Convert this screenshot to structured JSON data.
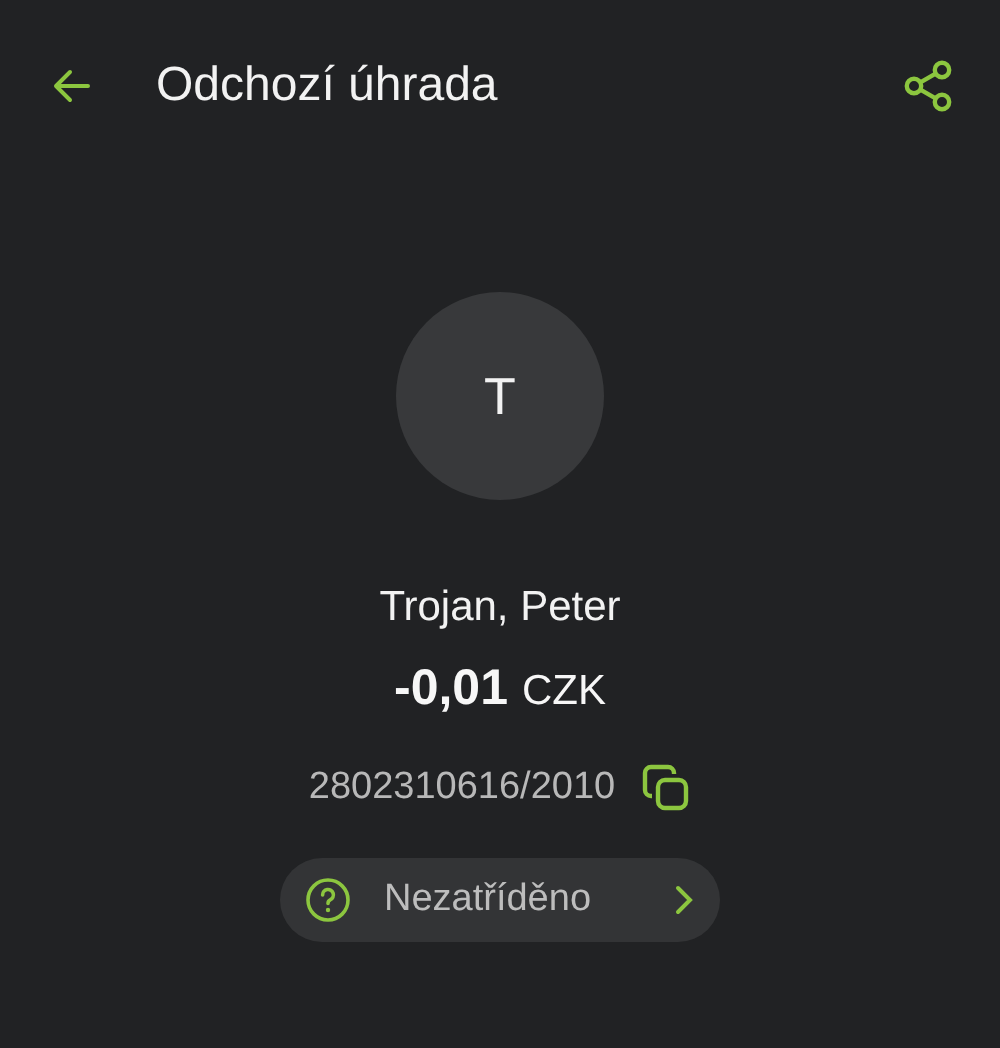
{
  "header": {
    "title": "Odchozí úhrada"
  },
  "counterparty": {
    "initial": "T",
    "name": "Trojan, Peter"
  },
  "amount": {
    "value": "-0,01",
    "currency": "CZK"
  },
  "account": "2802310616/2010",
  "category": {
    "label": "Nezatříděno"
  }
}
